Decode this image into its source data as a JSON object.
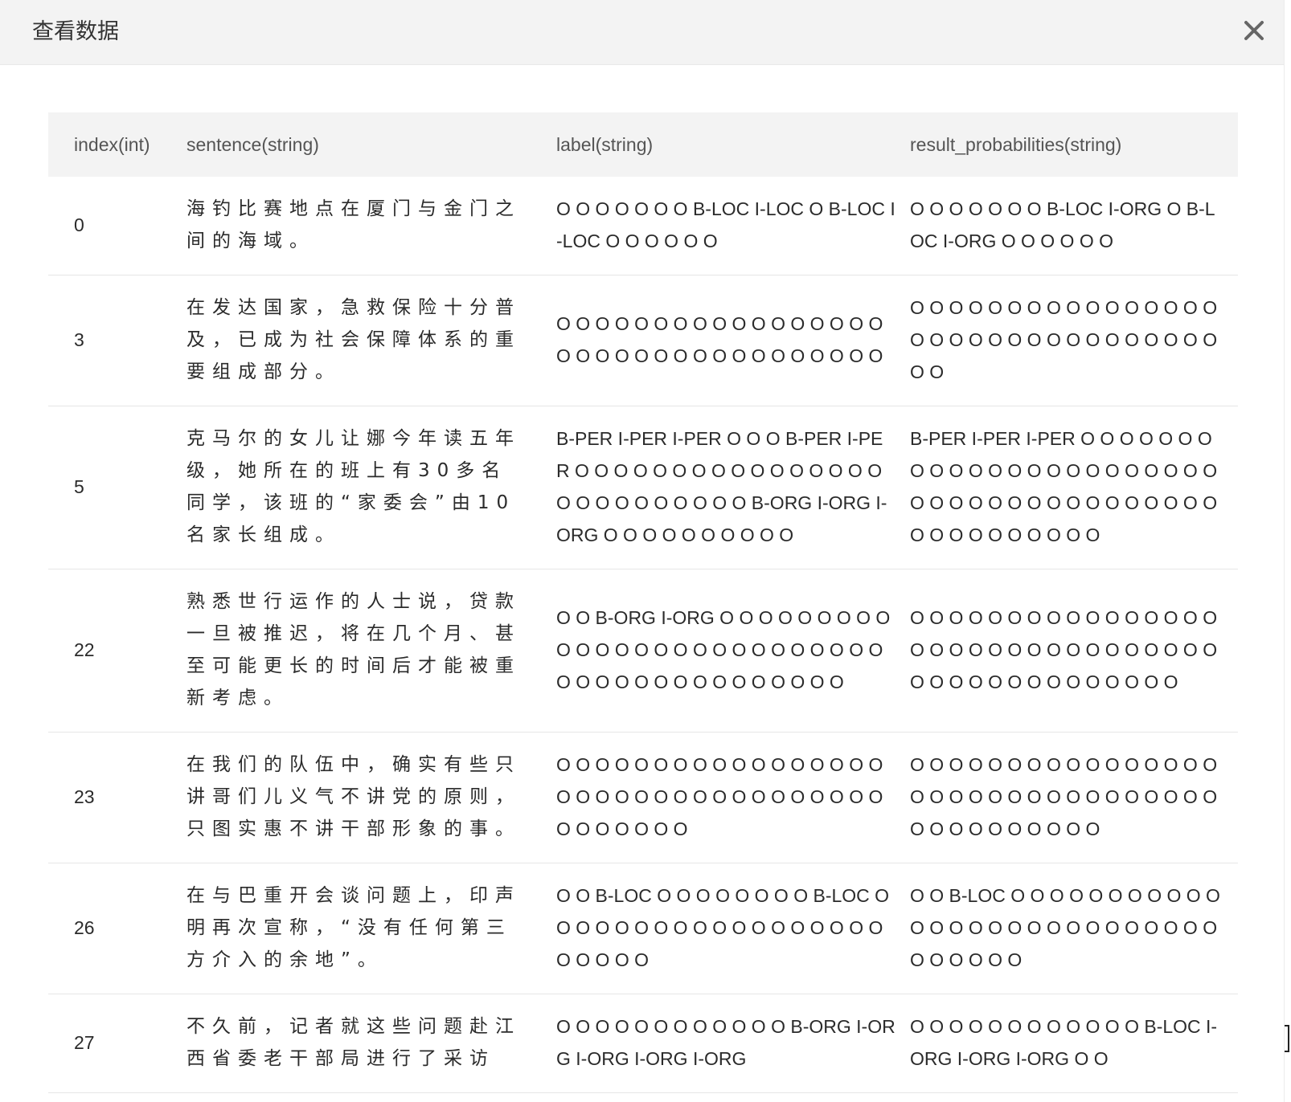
{
  "modal": {
    "title": "查看数据",
    "close_icon": "close-icon"
  },
  "table": {
    "columns": [
      "index(int)",
      "sentence(string)",
      "label(string)",
      "result_probabilities(string)"
    ],
    "rows": [
      {
        "index": "0",
        "sentence": "海钓比赛地点在厦门与金门之间的海域。",
        "label": "O O O O O O O B-LOC I-LOC O B-LOC I-LOC O O O O O O",
        "result_probabilities": "O O O O O O O B-LOC I-ORG O B-LOC I-ORG O O O O O O"
      },
      {
        "index": "3",
        "sentence": "在发达国家，急救保险十分普及，已成为社会保障体系的重要组成部分。",
        "label": "O O O O O O O O O O O O O O O O O O O O O O O O O O O O O O O O O O",
        "result_probabilities": "O O O O O O O O O O O O O O O O O O O O O O O O O O O O O O O O O O"
      },
      {
        "index": "5",
        "sentence": "克马尔的女儿让娜今年读五年级，她所在的班上有30多名同学，该班的“家委会”由10名家长组成。",
        "label": "B-PER I-PER I-PER O O O B-PER I-PER O O O O O O O O O O O O O O O O O O O O O O O O O O B-ORG I-ORG I-ORG O O O O O O O O O O",
        "result_probabilities": "B-PER I-PER I-PER O O O O O O O O O O O O O O O O O O O O O O O O O O O O O O O O O O O O O O O O O O O O O O O O O"
      },
      {
        "index": "22",
        "sentence": "熟悉世行运作的人士说，贷款一旦被推迟，将在几个月、甚至可能更长的时间后才能被重新考虑。",
        "label": "O O B-ORG I-ORG O O O O O O O O O O O O O O O O O O O O O O O O O O O O O O O O O O O O O O O O O",
        "result_probabilities": "O O O O O O O O O O O O O O O O O O O O O O O O O O O O O O O O O O O O O O O O O O O O O O"
      },
      {
        "index": "23",
        "sentence": "在我们的队伍中，确实有些只讲哥们儿义气不讲党的原则，只图实惠不讲干部形象的事。",
        "label": "O O O O O O O O O O O O O O O O O O O O O O O O O O O O O O O O O O O O O O O O O",
        "result_probabilities": "O O O O O O O O O O O O O O O O O O O O O O O O O O O O O O O O O O O O O O O O O O"
      },
      {
        "index": "26",
        "sentence": "在与巴重开会谈问题上，印声明再次宣称，“没有任何第三方介入的余地”。",
        "label": "O O B-LOC O O O O O O O O B-LOC O O O O O O O O O O O O O O O O O O O O O O O",
        "result_probabilities": "O O B-LOC O O O O O O O O O O O O O O O O O O O O O O O O O O O O O O O O O"
      },
      {
        "index": "27",
        "sentence": "不久前，记者就这些问题赴江西省委老干部局进行了采访",
        "label": "O O O O O O O O O O O O B-ORG I-ORG I-ORG I-ORG I-ORG",
        "result_probabilities": "O O O O O O O O O O O O B-LOC I-ORG I-ORG I-ORG O O"
      }
    ]
  }
}
